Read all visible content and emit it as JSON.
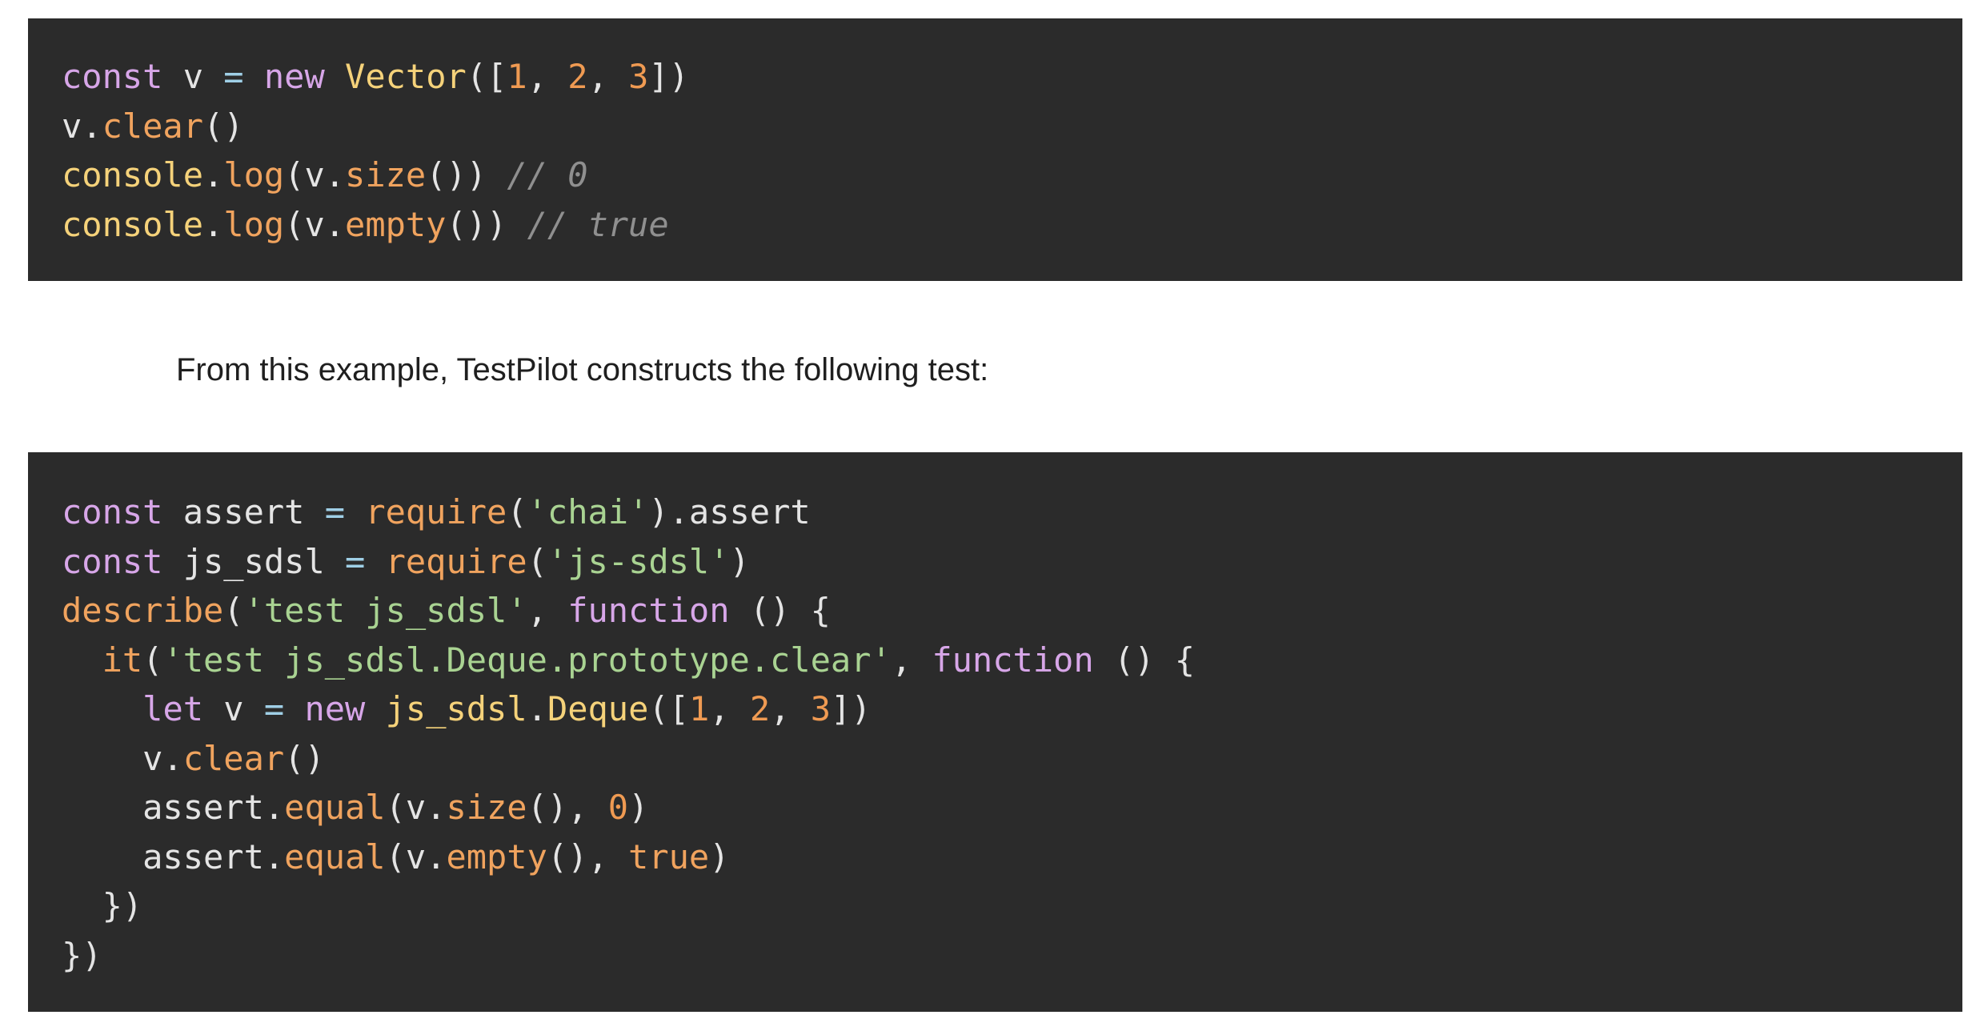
{
  "code_block_1": {
    "lines": [
      [
        {
          "t": "const",
          "c": "keyword"
        },
        {
          "t": " v ",
          "c": "default"
        },
        {
          "t": "=",
          "c": "op"
        },
        {
          "t": " ",
          "c": "default"
        },
        {
          "t": "new",
          "c": "keyword"
        },
        {
          "t": " ",
          "c": "default"
        },
        {
          "t": "Vector",
          "c": "class"
        },
        {
          "t": "([",
          "c": "default"
        },
        {
          "t": "1",
          "c": "number"
        },
        {
          "t": ", ",
          "c": "default"
        },
        {
          "t": "2",
          "c": "number"
        },
        {
          "t": ", ",
          "c": "default"
        },
        {
          "t": "3",
          "c": "number"
        },
        {
          "t": "])",
          "c": "default"
        }
      ],
      [
        {
          "t": "v.",
          "c": "default"
        },
        {
          "t": "clear",
          "c": "func"
        },
        {
          "t": "()",
          "c": "default"
        }
      ],
      [
        {
          "t": "console",
          "c": "class"
        },
        {
          "t": ".",
          "c": "default"
        },
        {
          "t": "log",
          "c": "func"
        },
        {
          "t": "(v.",
          "c": "default"
        },
        {
          "t": "size",
          "c": "func"
        },
        {
          "t": "()) ",
          "c": "default"
        },
        {
          "t": "// 0",
          "c": "comment"
        }
      ],
      [
        {
          "t": "console",
          "c": "class"
        },
        {
          "t": ".",
          "c": "default"
        },
        {
          "t": "log",
          "c": "func"
        },
        {
          "t": "(v.",
          "c": "default"
        },
        {
          "t": "empty",
          "c": "func"
        },
        {
          "t": "()) ",
          "c": "default"
        },
        {
          "t": "// true",
          "c": "comment"
        }
      ]
    ]
  },
  "prose": {
    "text": "From this example, TestPilot constructs the following test:"
  },
  "code_block_2": {
    "lines": [
      [
        {
          "t": "const",
          "c": "keyword"
        },
        {
          "t": " assert ",
          "c": "default"
        },
        {
          "t": "=",
          "c": "op"
        },
        {
          "t": " ",
          "c": "default"
        },
        {
          "t": "require",
          "c": "func"
        },
        {
          "t": "(",
          "c": "default"
        },
        {
          "t": "'chai'",
          "c": "string"
        },
        {
          "t": ").assert",
          "c": "default"
        }
      ],
      [
        {
          "t": "const",
          "c": "keyword"
        },
        {
          "t": " js_sdsl ",
          "c": "default"
        },
        {
          "t": "=",
          "c": "op"
        },
        {
          "t": " ",
          "c": "default"
        },
        {
          "t": "require",
          "c": "func"
        },
        {
          "t": "(",
          "c": "default"
        },
        {
          "t": "'js-sdsl'",
          "c": "string"
        },
        {
          "t": ")",
          "c": "default"
        }
      ],
      [
        {
          "t": "describe",
          "c": "func"
        },
        {
          "t": "(",
          "c": "default"
        },
        {
          "t": "'test js_sdsl'",
          "c": "string"
        },
        {
          "t": ", ",
          "c": "default"
        },
        {
          "t": "function",
          "c": "keyword"
        },
        {
          "t": " () {",
          "c": "default"
        }
      ],
      [
        {
          "t": "  ",
          "c": "default"
        },
        {
          "t": "it",
          "c": "func"
        },
        {
          "t": "(",
          "c": "default"
        },
        {
          "t": "'test js_sdsl.Deque.prototype.clear'",
          "c": "string"
        },
        {
          "t": ", ",
          "c": "default"
        },
        {
          "t": "function",
          "c": "keyword"
        },
        {
          "t": " () {",
          "c": "default"
        }
      ],
      [
        {
          "t": "    ",
          "c": "default"
        },
        {
          "t": "let",
          "c": "keyword"
        },
        {
          "t": " v ",
          "c": "default"
        },
        {
          "t": "=",
          "c": "op"
        },
        {
          "t": " ",
          "c": "default"
        },
        {
          "t": "new",
          "c": "keyword"
        },
        {
          "t": " ",
          "c": "default"
        },
        {
          "t": "js_sdsl",
          "c": "class"
        },
        {
          "t": ".",
          "c": "default"
        },
        {
          "t": "Deque",
          "c": "class"
        },
        {
          "t": "([",
          "c": "default"
        },
        {
          "t": "1",
          "c": "number"
        },
        {
          "t": ", ",
          "c": "default"
        },
        {
          "t": "2",
          "c": "number"
        },
        {
          "t": ", ",
          "c": "default"
        },
        {
          "t": "3",
          "c": "number"
        },
        {
          "t": "])",
          "c": "default"
        }
      ],
      [
        {
          "t": "    v.",
          "c": "default"
        },
        {
          "t": "clear",
          "c": "func"
        },
        {
          "t": "()",
          "c": "default"
        }
      ],
      [
        {
          "t": "    assert.",
          "c": "default"
        },
        {
          "t": "equal",
          "c": "func"
        },
        {
          "t": "(v.",
          "c": "default"
        },
        {
          "t": "size",
          "c": "func"
        },
        {
          "t": "(), ",
          "c": "default"
        },
        {
          "t": "0",
          "c": "number"
        },
        {
          "t": ")",
          "c": "default"
        }
      ],
      [
        {
          "t": "    assert.",
          "c": "default"
        },
        {
          "t": "equal",
          "c": "func"
        },
        {
          "t": "(v.",
          "c": "default"
        },
        {
          "t": "empty",
          "c": "func"
        },
        {
          "t": "(), ",
          "c": "default"
        },
        {
          "t": "true",
          "c": "func"
        },
        {
          "t": ")",
          "c": "default"
        }
      ],
      [
        {
          "t": "  })",
          "c": "default"
        }
      ],
      [
        {
          "t": "})",
          "c": "default"
        }
      ]
    ]
  }
}
